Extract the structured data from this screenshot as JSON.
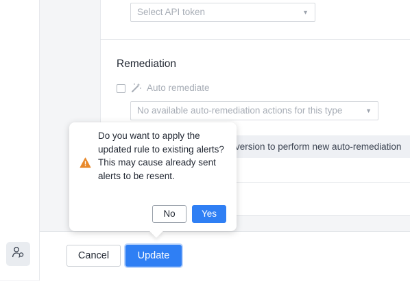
{
  "api_token": {
    "placeholder": "Select API token"
  },
  "remediation": {
    "title": "Remediation",
    "auto_remediate_label": "Auto remediate",
    "actions_placeholder": "No available auto-remediation actions for this type",
    "info_text": "version to perform new auto-remediation"
  },
  "footer": {
    "cancel_label": "Cancel",
    "update_label": "Update"
  },
  "confirm_popover": {
    "message": "Do you want to apply the updated rule to existing alerts? This may cause already sent alerts to be resent.",
    "no_label": "No",
    "yes_label": "Yes"
  },
  "colors": {
    "primary": "#2f7ff4",
    "warning": "#e8892b"
  }
}
